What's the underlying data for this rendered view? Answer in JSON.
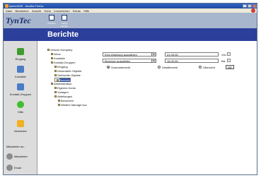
{
  "window": {
    "title": "tyntecSMS - Mozilla Firefox",
    "controls": [
      "_",
      "□",
      "x"
    ]
  },
  "menubar": [
    "Datei",
    "Bearbeiten",
    "Ansicht",
    "Gehe",
    "Lesezeichen",
    "Extras",
    "Hilfe"
  ],
  "header": {
    "logo": "TynTec",
    "buttons": [
      {
        "label": "Drucken",
        "icon": "printer-icon"
      },
      {
        "label": "Neues Fenster",
        "icon": "home-icon"
      }
    ]
  },
  "page_title": "Berichte",
  "sidebar": {
    "items": [
      {
        "label": "Eingang",
        "icon": "inbox-icon",
        "color": "#3f9b2f"
      },
      {
        "label": "Kontakte",
        "icon": "contacts-icon",
        "color": "#4a7cc7"
      },
      {
        "label": "Kontakt-Gruppen",
        "icon": "groups-icon",
        "color": "#4a7cc7"
      },
      {
        "label": "Hilfe",
        "icon": "help-icon",
        "color": "#3fbf2f"
      },
      {
        "label": "Abmelden",
        "icon": "logout-icon",
        "color": "#f0b020"
      }
    ],
    "mitarbeiter_label": "Mitarbeiter an:",
    "mitarbeiter": [
      {
        "label": "Mitarbeiter",
        "icon": "user-icon"
      },
      {
        "label": "Email",
        "icon": "email-icon"
      }
    ]
  },
  "tree": [
    {
      "label": "Verizon Kompany",
      "level": 0
    },
    {
      "label": "Inbox",
      "level": 1
    },
    {
      "label": "Kontakte",
      "level": 1
    },
    {
      "label": "Kontakt-Gruppen",
      "level": 1
    },
    {
      "label": "Eingang",
      "level": 2
    },
    {
      "label": "Gesendete Objekte",
      "level": 2
    },
    {
      "label": "Gelöschte Objekte",
      "level": 2
    },
    {
      "label": "Berichte",
      "level": 2,
      "selected": true
    },
    {
      "label": "Administration",
      "level": 1
    },
    {
      "label": "Eigenes Konto",
      "level": 2
    },
    {
      "label": "Vorlagen",
      "level": 2
    },
    {
      "label": "Abteilungen",
      "level": 2
    },
    {
      "label": "Benutzern",
      "level": 3
    },
    {
      "label": "Weitere Manage Acc",
      "level": 3
    }
  ],
  "form": {
    "department_select": "Eine Abteilung auswählen",
    "user_select": "Benutzer auswählen",
    "from_value": "01.05.06",
    "to_value": "16.05.06",
    "from_label": "Von",
    "to_label": "Bis",
    "radios": [
      {
        "label": "Summarbericht",
        "checked": true
      },
      {
        "label": "Detailbericht",
        "checked": false
      },
      {
        "label": "Übersicht",
        "checked": false
      }
    ],
    "ok_label": "OK"
  }
}
